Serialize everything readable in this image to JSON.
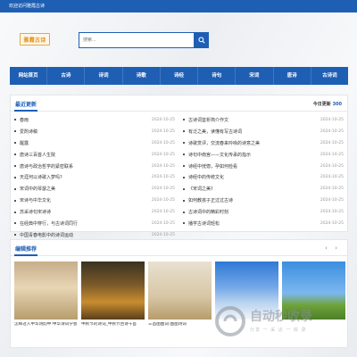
{
  "topbar": {
    "welcome": "欢迎访问雅霞古诗"
  },
  "logo": {
    "text": "雅霞古诗"
  },
  "search": {
    "placeholder": "搜索..."
  },
  "nav": {
    "items": [
      "网站首页",
      "古诗",
      "诗词",
      "诗歌",
      "诗经",
      "诗句",
      "宋词",
      "唐诗",
      "古诗词"
    ]
  },
  "latest": {
    "title": "最近更新",
    "today_label": "今日更新",
    "today_count": "300",
    "left": [
      {
        "title": "春雨",
        "date": "2024-10-25"
      },
      {
        "title": "爱酌诗稿",
        "date": "2024-10-25"
      },
      {
        "title": "醒露",
        "date": "2024-10-25"
      },
      {
        "title": "唐诗三百首人生院",
        "date": "2024-10-25"
      },
      {
        "title": "唐诗与政治哲学的紧密联系",
        "date": "2024-10-25"
      },
      {
        "title": "天涯何以诗歌入梦吗?",
        "date": "2024-10-25"
      },
      {
        "title": "宋词中的琴瑟之美",
        "date": "2024-10-25"
      },
      {
        "title": "宋诗与中华文化",
        "date": "2024-10-25"
      },
      {
        "title": "苏采诗句宋诗诗",
        "date": "2024-10-25"
      },
      {
        "title": "在经典中穿行，与古诗词同行",
        "date": "2024-10-25"
      },
      {
        "title": "中国青春电影中的诗词运动",
        "date": "2024-10-25"
      }
    ],
    "right": [
      {
        "title": "古诗词鉴析简介作文",
        "date": "2024-10-25"
      },
      {
        "title": "有泛之美，读懂有写古诗词",
        "date": "2024-10-25"
      },
      {
        "title": "诗歌赏评，交流春来吟咏的诗意之美",
        "date": "2024-10-25"
      },
      {
        "title": "诗句中南宫——文化传承的指示",
        "date": "2024-10-25"
      },
      {
        "title": "诗经中恍惚，孕如何检看",
        "date": "2024-10-25"
      },
      {
        "title": "诗经中的传统文化",
        "date": "2024-10-25"
      },
      {
        "title": "《宋词之美》",
        "date": "2024-10-25"
      },
      {
        "title": "如何教孩子正过过古诗",
        "date": "2024-10-25"
      },
      {
        "title": "古诗词中的精彩时刻",
        "date": "2024-10-25"
      },
      {
        "title": "播学古诗词轻松",
        "date": "2024-10-25"
      }
    ]
  },
  "featured": {
    "title": "编辑推荐",
    "arrows": "‹ ›",
    "cards": [
      {
        "caption": "怎样过入中华诗韵中:中华诗词学会"
      },
      {
        "caption": "中秋节的诗词_中秋节古诗十首"
      },
      {
        "caption": "三首图图词:图图诗词"
      },
      {
        "caption": ""
      },
      {
        "caption": ""
      }
    ]
  },
  "watermark": {
    "big": "自动秒收录",
    "small": "分享 一 采 访 一 收 录"
  },
  "colors": {
    "brand": "#1e5fb4",
    "logo_accent": "#e28d1c"
  }
}
